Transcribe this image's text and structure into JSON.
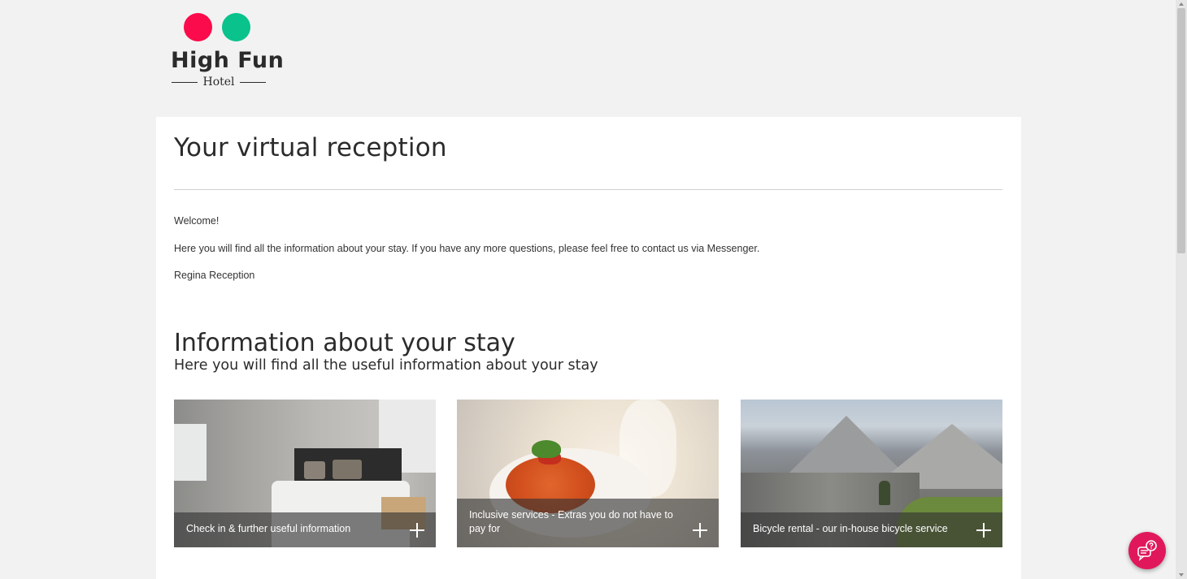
{
  "logo": {
    "brand": "High Fun",
    "sub": "Hotel",
    "colors": {
      "dot_left": "#fb0b4b",
      "dot_right": "#09c28c"
    }
  },
  "main": {
    "title": "Your virtual reception",
    "paragraphs": {
      "welcome": "Welcome!",
      "intro": "Here you will find all the information about your stay. If you have any more questions, please feel free to contact us via Messenger.",
      "signature": "Regina Reception"
    }
  },
  "info": {
    "title": "Information about your stay",
    "subtitle": "Here you will find all the useful information about your stay",
    "tiles": [
      {
        "label": "Check in & further useful information",
        "image": "hotel-bedroom"
      },
      {
        "label": "Inclusive services - Extras you do not have to pay for",
        "image": "spaghetti-dish"
      },
      {
        "label": "Bicycle rental - our in-house bicycle service",
        "image": "mountain-cyclist"
      }
    ]
  },
  "chat": {
    "icon": "chat-help-icon",
    "color": "#e0185b"
  }
}
